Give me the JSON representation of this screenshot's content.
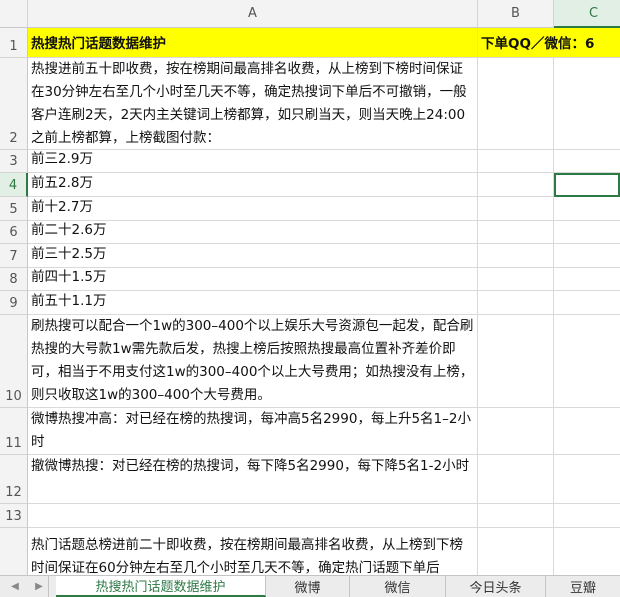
{
  "columns": [
    "A",
    "B",
    "C"
  ],
  "row_numbers": [
    "1",
    "2",
    "3",
    "4",
    "5",
    "6",
    "7",
    "8",
    "9",
    "10",
    "11",
    "12",
    "13",
    ""
  ],
  "cells": {
    "A1": "热搜热门话题数据维护",
    "B1": "下单QQ／微信：6",
    "A2": "热搜进前五十即收费，按在榜期间最高排名收费，从上榜到下榜时间保证在30分钟左右至几个小时至几天不等，确定热搜词下单后不可撤销，一般客户连刷2天，2天内主关键词上榜都算，如只刷当天，则当天晚上24:00之前上榜都算，上榜截图付款：",
    "A3": "前三2.9万",
    "A4": "前五2.8万",
    "A5": "前十2.7万",
    "A6": "前二十2.6万",
    "A7": "前三十2.5万",
    "A8": "前四十1.5万",
    "A9": "前五十1.1万",
    "A10": "刷热搜可以配合一个1w的300–400个以上娱乐大号资源包一起发，配合刷热搜的大号款1w需先款后发，热搜上榜后按照热搜最高位置补齐差价即可，相当于不用支付这1w的300–400个以上大号费用；如热搜没有上榜，则只收取这1w的300–400个大号费用。",
    "A11": "微博热搜冲高：对已经在榜的热搜词，每冲高5名2990，每上升5名1–2小时",
    "A12": "撤微博热搜：对已经在榜的热搜词，每下降5名2990，每下降5名1-2小时",
    "A13": "",
    "A14": "热门话题总榜进前二十即收费，按在榜期间最高排名收费，从上榜到下榜时间保证在60分钟左右至几个小时至几天不等，确定热门话题下单后"
  },
  "sheet_tabs": [
    "热搜热门话题数据维护",
    "微博",
    "微信",
    "今日头条",
    "豆瓣"
  ],
  "active_tab_index": 0,
  "active_cell": "C4",
  "colors": {
    "highlight": "#ffff00",
    "accent": "#2d7a45"
  }
}
